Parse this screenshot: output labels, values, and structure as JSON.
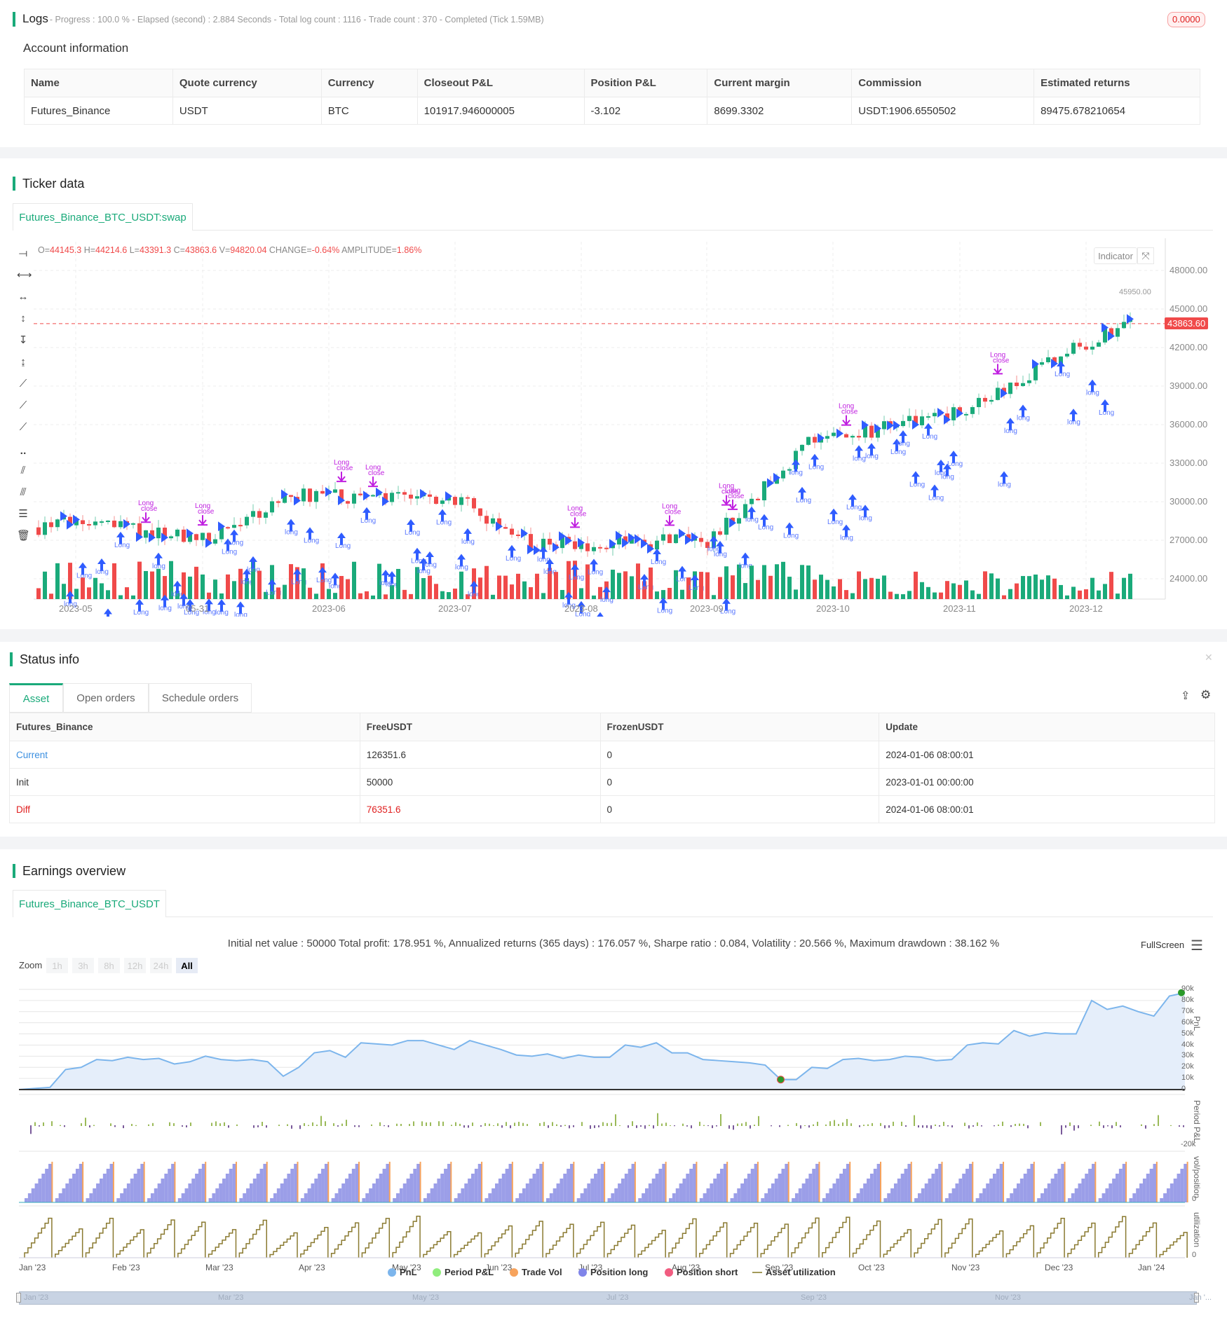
{
  "logs": {
    "title": "Logs",
    "summary": "- Progress : 100.0 % - Elapsed (second) : 2.884  Seconds - Total log count : 1116 - Trade count : 370 - Completed (Tick 1.59MB)",
    "badge": "0.0000"
  },
  "account": {
    "title": "Account information",
    "headers": [
      "Name",
      "Quote currency",
      "Currency",
      "Closeout P&L",
      "Position P&L",
      "Current margin",
      "Commission",
      "Estimated returns"
    ],
    "row": [
      "Futures_Binance",
      "USDT",
      "BTC",
      "101917.946000005",
      "-3.102",
      "8699.3302",
      "USDT:1906.6550502",
      "89475.678210654"
    ]
  },
  "ticker": {
    "title": "Ticker data",
    "tab": "Futures_Binance_BTC_USDT:swap",
    "ohlc": [
      {
        "k": "O=",
        "v": "44145.3"
      },
      {
        "k": " H=",
        "v": "44214.6"
      },
      {
        "k": " L=",
        "v": "43391.3"
      },
      {
        "k": " C=",
        "v": "43863.6"
      },
      {
        "k": " V=",
        "v": "94820.04"
      },
      {
        "k": " CHANGE=",
        "v": "-0.64%"
      },
      {
        "k": " AMPLITUDE=",
        "v": "1.86%"
      }
    ],
    "indicator_label": "Indicator",
    "last_price": "43863.60",
    "high_label": "45950.00",
    "y_ticks": [
      "48000.00",
      "45000.00",
      "42000.00",
      "39000.00",
      "36000.00",
      "33000.00",
      "30000.00",
      "27000.00",
      "24000.00"
    ],
    "x_ticks": [
      "2023-05",
      "05-31",
      "2023-06",
      "2023-07",
      "2023-08",
      "2023-09",
      "2023-10",
      "2023-11",
      "2023-12"
    ],
    "anchor_closes": [
      28000,
      28500,
      27000,
      30500,
      30200,
      26600,
      27000,
      34500,
      37000,
      42500,
      43863.6
    ],
    "marker_labels": {
      "long": "Long",
      "close": "close",
      "long_small": "long"
    },
    "colors": {
      "up": "#1aaa7a",
      "down": "#f04a4a",
      "marker": "#2f5cff",
      "signal": "#c020e0"
    }
  },
  "status": {
    "title": "Status info",
    "tabs": [
      "Asset",
      "Open orders",
      "Schedule orders"
    ],
    "headers": [
      "Futures_Binance",
      "FreeUSDT",
      "FrozenUSDT",
      "Update"
    ],
    "rows": [
      [
        "Current",
        "126351.6",
        "0",
        "2024-01-06 08:00:01"
      ],
      [
        "Init",
        "50000",
        "0",
        "2023-01-01 00:00:00"
      ],
      [
        "Diff",
        "76351.6",
        "0",
        "2024-01-06 08:00:01"
      ]
    ]
  },
  "earnings": {
    "title": "Earnings overview",
    "tab": "Futures_Binance_BTC_USDT",
    "summary": "Initial net value : 50000 Total profit: 178.951 %, Annualized returns (365 days) : 176.057 %, Sharpe ratio : 0.084, Volatility : 20.566 %, Maximum drawdown : 38.162 %",
    "fullscreen": "FullScreen",
    "zoom_label": "Zoom",
    "zoom_options": [
      "1h",
      "3h",
      "8h",
      "12h",
      "24h",
      "All"
    ],
    "pnl_ticks": [
      "90k",
      "80k",
      "70k",
      "60k",
      "50k",
      "40k",
      "30k",
      "20k",
      "10k",
      "0"
    ],
    "pnl_k": [
      0,
      1,
      2,
      18,
      20,
      27,
      26,
      29,
      27,
      28,
      23,
      25,
      30,
      27,
      26,
      27,
      25,
      12,
      20,
      33,
      35,
      29,
      42,
      41,
      40,
      44,
      44,
      40,
      36,
      44,
      40,
      36,
      31,
      30,
      32,
      28,
      31,
      29,
      29,
      40,
      38,
      42,
      33,
      33,
      27,
      26,
      25,
      24,
      22,
      9,
      9,
      20,
      19,
      27,
      28,
      26,
      27,
      30,
      29,
      26,
      27,
      40,
      42,
      41,
      53,
      48,
      51,
      50,
      50,
      80,
      72,
      75,
      70,
      66,
      84,
      87
    ],
    "period_label": "Period P&L",
    "period_min": "-20k",
    "vol_label": "vol/position",
    "vol_zero": "0",
    "util_label": "utilization",
    "util_zero": "0",
    "pnl_axis": "PnL",
    "x_ticks": [
      "Jan '23",
      "Feb '23",
      "Mar '23",
      "Apr '23",
      "May '23",
      "Jun '23",
      "Jul '23",
      "Aug '23",
      "Sep '23",
      "Oct '23",
      "Nov '23",
      "Dec '23",
      "Jan '24"
    ],
    "legend": [
      {
        "label": "PnL",
        "color": "#7cb5ec"
      },
      {
        "label": "Period P&L",
        "color": "#90ed7d"
      },
      {
        "label": "Trade Vol",
        "color": "#f7a35c"
      },
      {
        "label": "Position long",
        "color": "#8085e9"
      },
      {
        "label": "Position short",
        "color": "#f15c80"
      },
      {
        "label": "Asset utilization",
        "color": "#a39a5a"
      }
    ],
    "nav_ticks": [
      "Jan '23",
      "Mar '23",
      "May '23",
      "Jul '23",
      "Sep '23",
      "Nov '23",
      "Jan '..."
    ]
  }
}
